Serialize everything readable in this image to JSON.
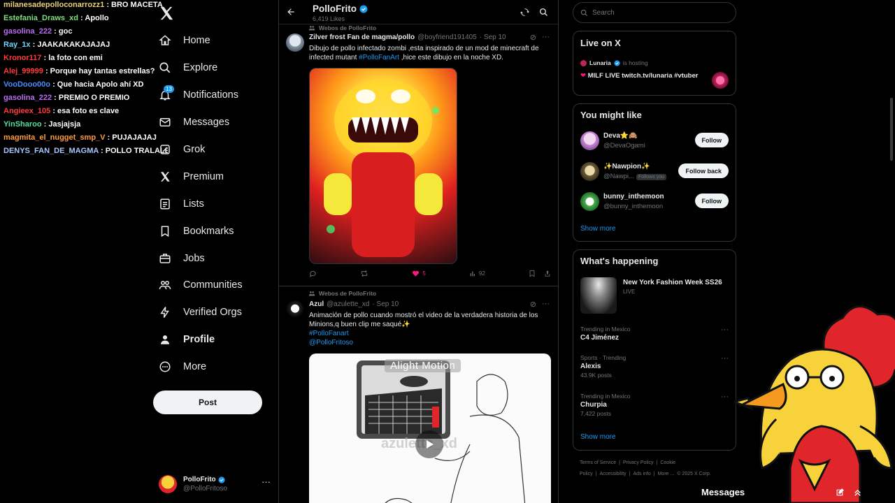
{
  "chat": {
    "lines": [
      {
        "user": "milanesadepolloconarrozz1",
        "color": "#e8d27a",
        "msg": "BRO MACETA"
      },
      {
        "user": "Estefania_Draws_xd",
        "color": "#7fe07f",
        "msg": "Apollo"
      },
      {
        "user": "gasolina_222",
        "color": "#b86cf0",
        "msg": "goc"
      },
      {
        "user": "Ray_1x",
        "color": "#6fd6ff",
        "msg": "JAAKAKAKAJAJAJ"
      },
      {
        "user": "Kronor117",
        "color": "#ff3b3b",
        "msg": "la foto con emi"
      },
      {
        "user": "Alej_99999",
        "color": "#ff3b3b",
        "msg": "Porque hay tantas estrellas?"
      },
      {
        "user": "VooDooo00o",
        "color": "#4a8cff",
        "msg": "Que hacia Apolo ahí XD"
      },
      {
        "user": "gasolina_222",
        "color": "#b86cf0",
        "msg": "PREMIO O PREMIO"
      },
      {
        "user": "Angieex_105",
        "color": "#ff3b3b",
        "msg": "esa foto es clave"
      },
      {
        "user": "YinSharoo",
        "color": "#55e0a0",
        "msg": "Jasjajsja"
      },
      {
        "user": "magmita_el_nugget_smp_V",
        "color": "#ff9a3b",
        "msg": "PUJAJAJAJ"
      },
      {
        "user": "DENYS_FAN_DE_MAGMA",
        "color": "#a8c8ff",
        "msg": "POLLO TRALALERO"
      }
    ]
  },
  "nav": {
    "items": [
      {
        "label": "Home",
        "icon": "home-icon"
      },
      {
        "label": "Explore",
        "icon": "search-icon"
      },
      {
        "label": "Notifications",
        "icon": "bell-icon",
        "badge": "13"
      },
      {
        "label": "Messages",
        "icon": "envelope-icon"
      },
      {
        "label": "Grok",
        "icon": "grok-icon"
      },
      {
        "label": "Premium",
        "icon": "x-premium-icon"
      },
      {
        "label": "Lists",
        "icon": "lists-icon"
      },
      {
        "label": "Bookmarks",
        "icon": "bookmark-icon"
      },
      {
        "label": "Jobs",
        "icon": "briefcase-icon"
      },
      {
        "label": "Communities",
        "icon": "communities-icon"
      },
      {
        "label": "Verified Orgs",
        "icon": "lightning-icon"
      },
      {
        "label": "Profile",
        "icon": "person-icon"
      },
      {
        "label": "More",
        "icon": "more-circle-icon"
      }
    ],
    "post_label": "Post",
    "account": {
      "name": "PolloFrito",
      "handle": "@PolloFritoso"
    }
  },
  "feed": {
    "title": "PolloFrito",
    "subtitle": "6,419 Likes",
    "tweets": [
      {
        "context": "Webos de PolloFrito",
        "name": "Zilver frost Fan de magma/pollo",
        "handle": "@boyfriend191405",
        "date": "· Sep 10",
        "text": "Dibujo de pollo infectado zombi ,esta inspirado de un mod de minecraft de infected mutant",
        "hashtag": "#PolloFanArt",
        "text_after": " ,hice este dibujo en la noche XD.",
        "likes": "5",
        "views": "92"
      },
      {
        "context": "Webos de PolloFrito",
        "name": "Azul",
        "handle": "@azulette_xd",
        "date": "· Sep 10",
        "text": "Animación de pollo cuando mostró el video de la verdadera historia de los Minions,q buen clip me saqué✨",
        "hashtag": "#PolloFanart",
        "mention": "@PolloFritoso",
        "video_watermark": "Alight Motion",
        "video_overlay": "azulette_xd"
      }
    ]
  },
  "right": {
    "search_placeholder": "Search",
    "live": {
      "title": "Live on X",
      "host": "Lunaria",
      "host_suffix": "is hosting",
      "stream": "MILF LIVE twitch.tv/lunaria #vtuber"
    },
    "might_like": {
      "title": "You might like",
      "users": [
        {
          "name": "Deva⭐🙈",
          "handle": "@DevaOgami",
          "button": "Follow"
        },
        {
          "name": "✨Nawpion✨",
          "handle": "@Nawpi...",
          "follows_you": "Follows you",
          "button": "Follow back"
        },
        {
          "name": "bunny_inthemoon",
          "handle": "@bunny_inthemoon",
          "button": "Follow"
        }
      ],
      "show_more": "Show more"
    },
    "happening": {
      "title": "What's happening",
      "event": {
        "title": "New York Fashion Week SS26",
        "status": "LIVE"
      },
      "trends": [
        {
          "context": "Trending in Mexico",
          "title": "C4 Jiménez",
          "count": ""
        },
        {
          "context": "Sports · Trending",
          "title": "Alexis",
          "count": "43.9K posts"
        },
        {
          "context": "Trending in Mexico",
          "title": "Churpia",
          "count": "7,422 posts"
        }
      ],
      "show_more": "Show more"
    },
    "footer": [
      "Terms of Service",
      "|",
      "Privacy Policy",
      "|",
      "Cookie Policy",
      "|",
      "Accessibility",
      "|",
      "Ads info",
      "|",
      "More ...",
      "© 2025 X Corp."
    ]
  },
  "messages_drawer": {
    "label": "Messages"
  },
  "colors": {
    "accent": "#1d9bf0",
    "background": "#000000",
    "like_pink": "#f91880",
    "chicken_yellow": "#f7d23a",
    "chicken_red": "#e0252b"
  }
}
